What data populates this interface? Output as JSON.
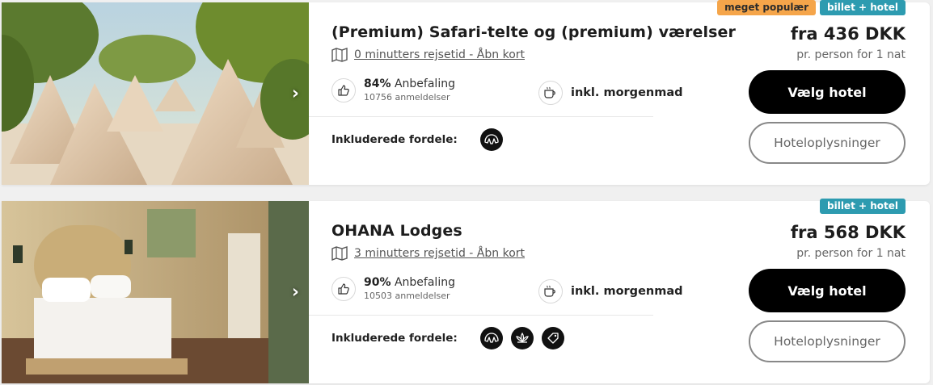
{
  "listings": [
    {
      "title": "(Premium) Safari-telte og (premium) værelser",
      "travel_link": "0 minutters rejsetid - Åbn kort",
      "recommend_pct": "84%",
      "recommend_label": "Anbefaling",
      "reviews": "10756 anmeldelser",
      "breakfast": "inkl. morgenmad",
      "benefits_label": "Inkluderede fordele:",
      "benefit_icons": [
        "croissant-icon"
      ],
      "badges": [
        "meget populær",
        "billet + hotel"
      ],
      "price": "fra 436 DKK",
      "price_sub": "pr. person for 1 nat",
      "select_button": "Vælg hotel",
      "info_button": "Hoteloplysninger",
      "image": "safari-tents-photo"
    },
    {
      "title": "OHANA Lodges",
      "travel_link": "3 minutters rejsetid - Åbn kort",
      "recommend_pct": "90%",
      "recommend_label": "Anbefaling",
      "reviews": "10503 anmeldelser",
      "breakfast": "inkl. morgenmad",
      "benefits_label": "Inkluderede fordele:",
      "benefit_icons": [
        "croissant-icon",
        "lotus-icon",
        "tag-icon"
      ],
      "badges": [
        "billet + hotel"
      ],
      "price": "fra 568 DKK",
      "price_sub": "pr. person for 1 nat",
      "select_button": "Vælg hotel",
      "info_button": "Hoteloplysninger",
      "image": "hotel-room-photo"
    }
  ],
  "colors": {
    "badge_orange": "#f5a54a",
    "badge_teal": "#2d9bb0",
    "button_primary": "#000000"
  }
}
